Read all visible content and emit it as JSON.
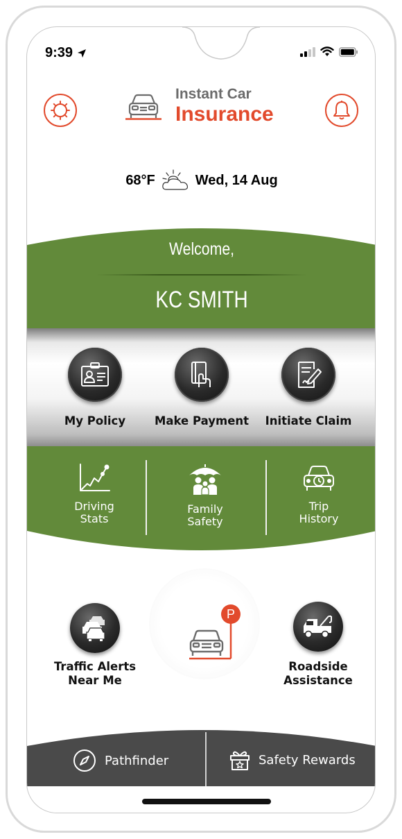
{
  "status": {
    "time": "9:39"
  },
  "brand": {
    "line1": "Instant Car",
    "line2": "Insurance"
  },
  "weather": {
    "temperature": "68°F",
    "date": "Wed, 14 Aug"
  },
  "welcome": {
    "greeting": "Welcome,",
    "user_name": "KC SMITH"
  },
  "actions": [
    {
      "label": "My Policy",
      "icon": "policy-id-card-icon"
    },
    {
      "label": "Make Payment",
      "icon": "payment-card-hand-icon"
    },
    {
      "label": "Initiate Claim",
      "icon": "claim-document-pen-icon"
    }
  ],
  "stats": [
    {
      "label_line1": "Driving",
      "label_line2": "Stats",
      "icon": "chart-line-icon"
    },
    {
      "label_line1": "Family",
      "label_line2": "Safety",
      "icon": "family-umbrella-icon"
    },
    {
      "label_line1": "Trip",
      "label_line2": "History",
      "icon": "car-history-icon"
    }
  ],
  "lower": {
    "traffic": {
      "line1": "Traffic Alerts",
      "line2": "Near Me",
      "icon": "traffic-cars-icon"
    },
    "roadside": {
      "line1": "Roadside",
      "line2": "Assistance",
      "icon": "tow-truck-icon"
    },
    "parking": {
      "badge": "P",
      "icon": "parked-car-icon"
    }
  },
  "bottom_tabs": [
    {
      "label": "Pathfinder",
      "icon": "compass-icon"
    },
    {
      "label": "Safety Rewards",
      "icon": "gift-star-icon"
    }
  ],
  "colors": {
    "accent_red": "#e24a2c",
    "band_green": "#628a3a",
    "dark_gray": "#4a4a4a",
    "text_gray": "#6b6b6b"
  }
}
